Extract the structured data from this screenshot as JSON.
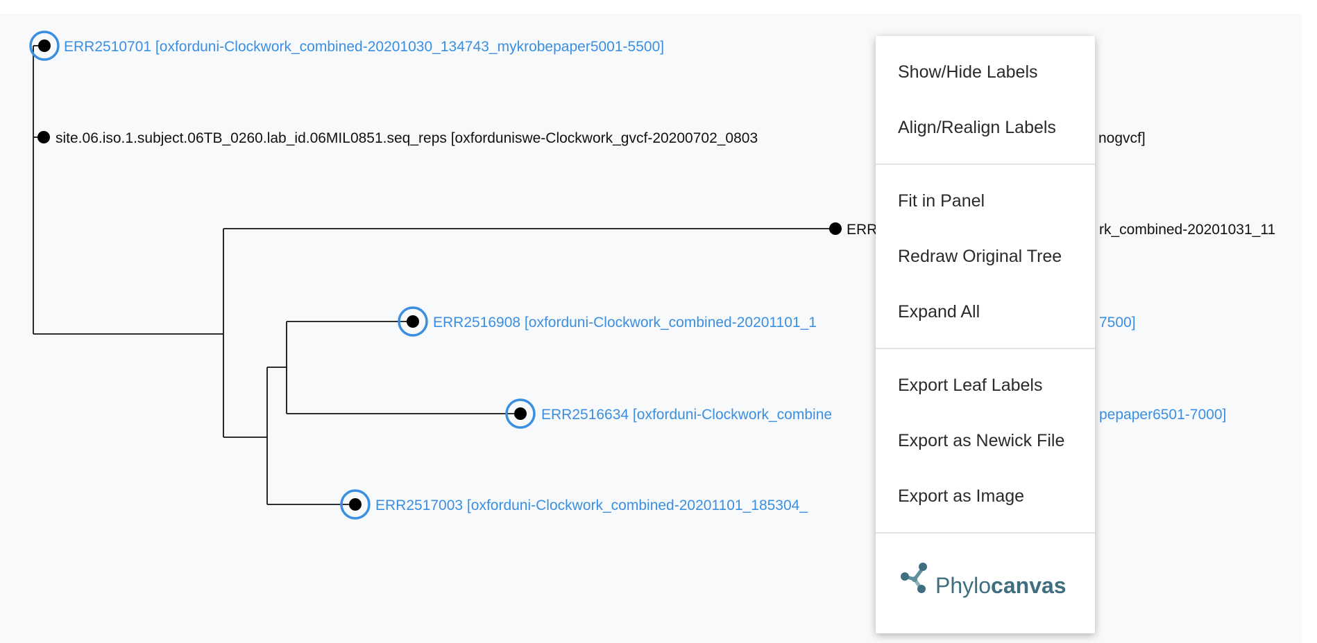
{
  "tree": {
    "leaves": [
      {
        "id": "leaf-1",
        "label": "ERR2510701 [oxforduni-Clockwork_combined-20201030_134743_mykrobepaper5001-5500]",
        "highlighted": true
      },
      {
        "id": "leaf-2",
        "label": "site.06.iso.1.subject.06TB_0260.lab_id.06MIL0851.seq_reps [oxforduniswe-Clockwork_gvcf-20200702_0803",
        "label_suffix": "nogvcf]",
        "highlighted": false
      },
      {
        "id": "leaf-3",
        "label": "ERR",
        "label_suffix": "rk_combined-20201031_11",
        "highlighted": false
      },
      {
        "id": "leaf-4",
        "label": "ERR2516908 [oxforduni-Clockwork_combined-20201101_1",
        "label_suffix": "7500]",
        "highlighted": true
      },
      {
        "id": "leaf-5",
        "label": "ERR2516634 [oxforduni-Clockwork_combine",
        "label_suffix": "pepaper6501-7000]",
        "highlighted": true
      },
      {
        "id": "leaf-6",
        "label": "ERR2517003 [oxforduni-Clockwork_combined-20201101_185304_",
        "highlighted": true
      }
    ],
    "colors": {
      "highlight": "#3a8fe0",
      "branch": "#111111",
      "background": "#f8f9fb"
    }
  },
  "context_menu": {
    "groups": [
      [
        {
          "id": "show-hide-labels",
          "label": "Show/Hide Labels"
        },
        {
          "id": "align-realign-labels",
          "label": "Align/Realign Labels"
        }
      ],
      [
        {
          "id": "fit-in-panel",
          "label": "Fit in Panel"
        },
        {
          "id": "redraw-original-tree",
          "label": "Redraw Original Tree"
        },
        {
          "id": "expand-all",
          "label": "Expand All"
        }
      ],
      [
        {
          "id": "export-leaf-labels",
          "label": "Export Leaf Labels"
        },
        {
          "id": "export-newick-file",
          "label": "Export as Newick File"
        },
        {
          "id": "export-image",
          "label": "Export as Image"
        }
      ]
    ],
    "brand": {
      "name_light": "Phylo",
      "name_bold": "canvas",
      "icon": "phylocanvas-logo-icon",
      "color": "#3e6e7f"
    }
  }
}
